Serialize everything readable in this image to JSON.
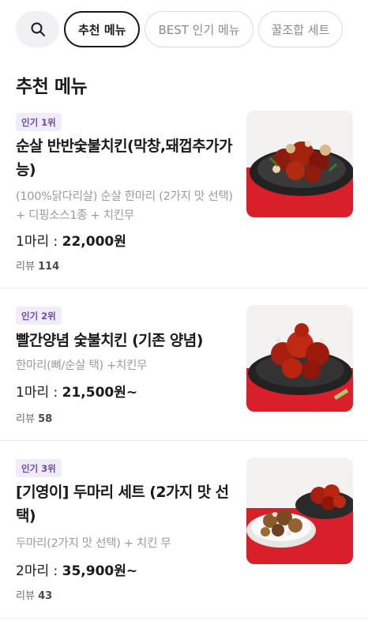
{
  "tabs": [
    {
      "label": "추천 메뉴",
      "active": true
    },
    {
      "label": "BEST 인기 메뉴",
      "active": false
    },
    {
      "label": "꿀조합 세트",
      "active": false
    }
  ],
  "section_title": "추천 메뉴",
  "items": [
    {
      "badge": "인기 1위",
      "name": "순살 반반숯불치킨(막창,돼껍추가가능)",
      "desc": "(100%닭다리살) 순살 한마리 (2가지 맛 선택) + 디핑소스1종 + 치킨무",
      "price_prefix": "1마리 : ",
      "price": "22,000원",
      "review_label": "리뷰",
      "review_count": "114"
    },
    {
      "badge": "인기 2위",
      "name": "빨간양념 숯불치킨 (기존 양념)",
      "desc": "한마리(뼈/순살 택) +치킨무",
      "price_prefix": "1마리 : ",
      "price": "21,500원~",
      "review_label": "리뷰",
      "review_count": "58"
    },
    {
      "badge": "인기 3위",
      "name": "[기영이] 두마리 세트 (2가지 맛 선택)",
      "desc": "두마리(2가지 맛 선택) + 치킨 무",
      "price_prefix": "2마리 : ",
      "price": "35,900원~",
      "review_label": "리뷰",
      "review_count": "43"
    }
  ]
}
